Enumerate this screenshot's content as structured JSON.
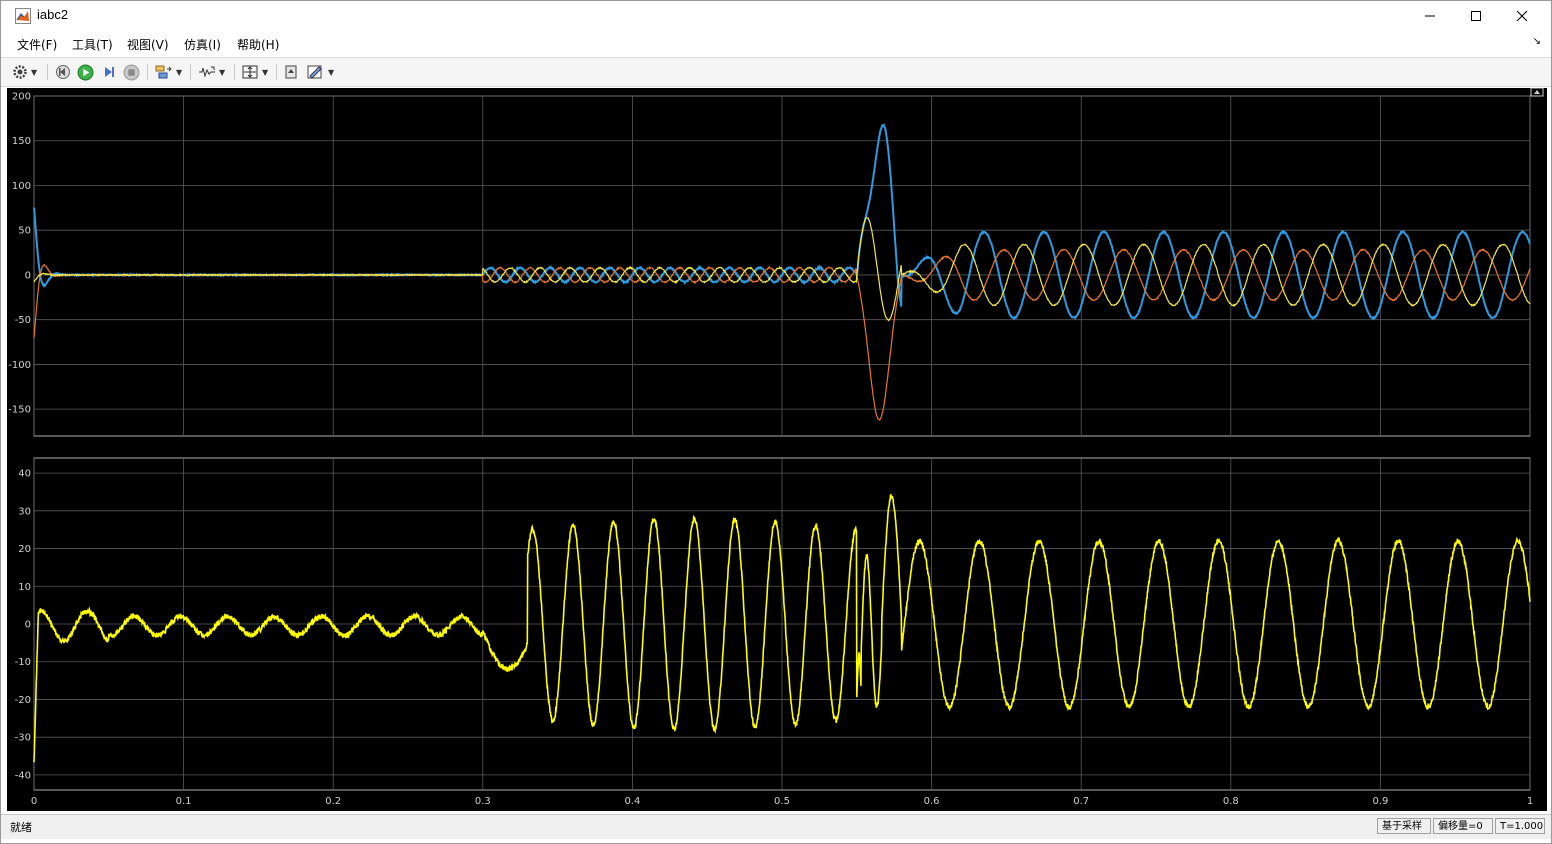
{
  "window": {
    "title": "iabc2",
    "controls": [
      "minimize",
      "maximize",
      "close"
    ]
  },
  "menu": [
    "文件(F)",
    "工具(T)",
    "视图(V)",
    "仿真(I)",
    "帮助(H)"
  ],
  "toolbar": {
    "buttons": [
      "settings-icon",
      "step-back-icon",
      "run-icon",
      "step-forward-icon",
      "stop-icon",
      "simulation-data-icon",
      "zoom-trigger-icon",
      "autoscale-icon",
      "restore-icon",
      "style-icon"
    ]
  },
  "colors": {
    "phase_a": "#2e9ae0",
    "phase_b": "#e8762e",
    "phase_c": "#f2e84a",
    "signal": "#ffff00",
    "grid": "#5a5a5a",
    "background": "#000000"
  },
  "chart_data": [
    {
      "type": "line",
      "title": "",
      "x_ticks": [
        "0",
        "0.1",
        "0.2",
        "0.3",
        "0.4",
        "0.5",
        "0.6",
        "0.7",
        "0.8",
        "0.9",
        "1"
      ],
      "y_ticks": [
        "200",
        "150",
        "100",
        "50",
        "0",
        "-50",
        "-100",
        "-150"
      ],
      "xlim": [
        0,
        1
      ],
      "ylim": [
        -180,
        200
      ],
      "grid": true,
      "segments": [
        {
          "from": 0,
          "to": 0.02,
          "description": "startup transient",
          "peak": 75,
          "trough": -70
        },
        {
          "from": 0.02,
          "to": 0.3,
          "amplitude": 0
        },
        {
          "from": 0.3,
          "to": 0.55,
          "amplitude": 8,
          "frequency": 50
        },
        {
          "from": 0.55,
          "to": 0.58,
          "description": "fault transient",
          "phase_a_peak": 165,
          "phase_b_trough": -142,
          "phase_c_peak": 72
        },
        {
          "from": 0.58,
          "to": 1,
          "amplitudes": {
            "phase_a": 48,
            "phase_b": 28,
            "phase_c": 34
          },
          "frequency": 25
        }
      ],
      "series": [
        {
          "color": "#2e9ae0"
        },
        {
          "color": "#e8762e"
        },
        {
          "color": "#f2e84a"
        }
      ]
    },
    {
      "type": "line",
      "title": "",
      "x_ticks": [
        "0",
        "0.1",
        "0.2",
        "0.3",
        "0.4",
        "0.5",
        "0.6",
        "0.7",
        "0.8",
        "0.9",
        "1"
      ],
      "y_ticks": [
        "40",
        "30",
        "20",
        "10",
        "0",
        "-10",
        "-20",
        "-30",
        "-40"
      ],
      "xlim": [
        0,
        1
      ],
      "ylim": [
        -44,
        44
      ],
      "grid": true,
      "segments": [
        {
          "from": 0,
          "to": 0.3,
          "offset": -0.5,
          "amplitude": 2.5,
          "frequency": 32
        },
        {
          "from": 0.3,
          "to": 0.33,
          "description": "dip",
          "min": -12
        },
        {
          "from": 0.33,
          "to": 0.55,
          "amplitude": 25,
          "frequency": 37
        },
        {
          "from": 0.55,
          "to": 0.58,
          "description": "fault transient",
          "peak": 34,
          "trough": -28
        },
        {
          "from": 0.58,
          "to": 1,
          "amplitude": 22,
          "frequency": 25
        }
      ],
      "series": [
        {
          "color": "#ffff00"
        }
      ]
    }
  ],
  "status": {
    "text": "就绪",
    "sampling": "基于采样",
    "offset": "偏移量=0",
    "time": "T=1.000"
  }
}
